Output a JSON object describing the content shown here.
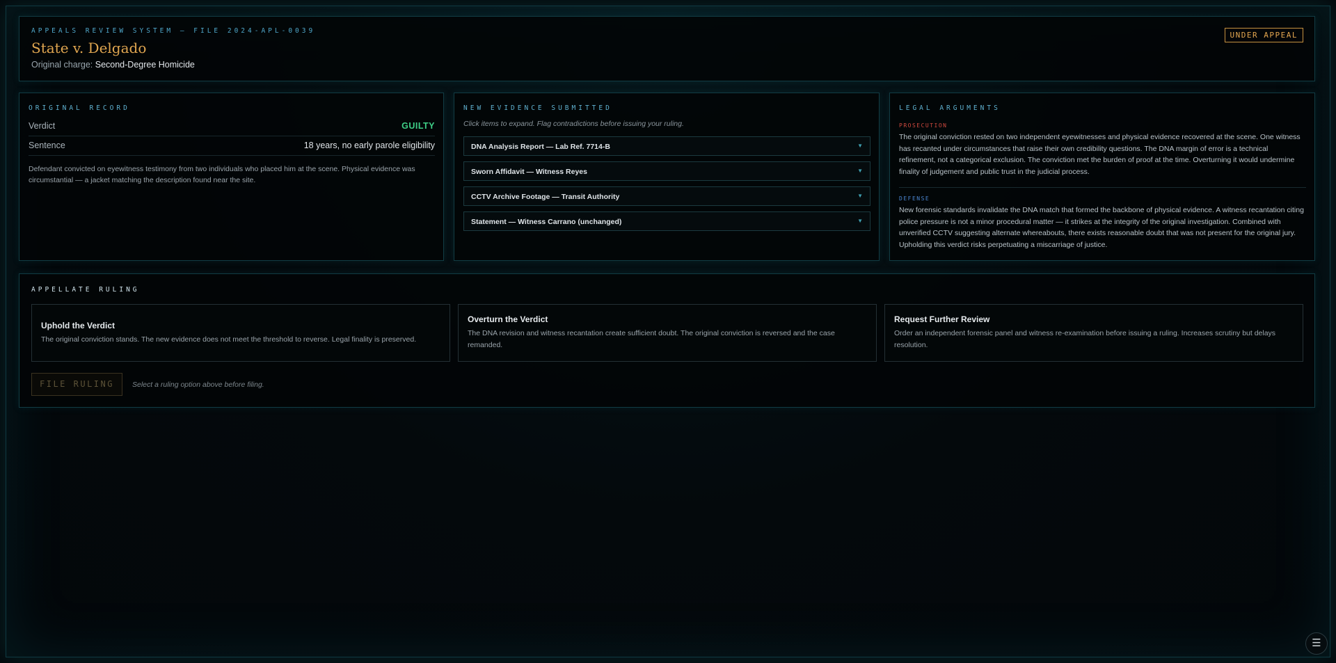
{
  "header": {
    "kicker": "APPEALS REVIEW SYSTEM — FILE 2024-APL-0039",
    "case_title": "State v. Delgado",
    "charge_label": "Original charge:",
    "charge_value": "Second-Degree Homicide",
    "status_badge": "UNDER APPEAL"
  },
  "record": {
    "title": "ORIGINAL RECORD",
    "rows": [
      {
        "label": "Verdict",
        "value": "GUILTY"
      },
      {
        "label": "Sentence",
        "value": "18 years, no early parole eligibility"
      }
    ],
    "note": "Defendant convicted on eyewitness testimony from two individuals who placed him at the scene. Physical evidence was circumstantial — a jacket matching the description found near the site."
  },
  "evidence": {
    "title": "NEW EVIDENCE SUBMITTED",
    "hint": "Click items to expand. Flag contradictions before issuing your ruling.",
    "items": [
      {
        "label": "DNA Analysis Report — Lab Ref. 7714-B",
        "icon": "chevron-down-icon"
      },
      {
        "label": "Sworn Affidavit — Witness Reyes",
        "icon": "chevron-down-icon"
      },
      {
        "label": "CCTV Archive Footage — Transit Authority",
        "icon": "chevron-down-icon"
      },
      {
        "label": "Statement — Witness Carrano (unchanged)",
        "icon": "chevron-down-icon"
      }
    ]
  },
  "arguments": {
    "title": "LEGAL ARGUMENTS",
    "prosecution": {
      "label": "PROSECUTION",
      "text": "The original conviction rested on two independent eyewitnesses and physical evidence recovered at the scene. One witness has recanted under circumstances that raise their own credibility questions. The DNA margin of error is a technical refinement, not a categorical exclusion. The conviction met the burden of proof at the time. Overturning it would undermine finality of judgement and public trust in the judicial process."
    },
    "defense": {
      "label": "DEFENSE",
      "text": "New forensic standards invalidate the DNA match that formed the backbone of physical evidence. A witness recantation citing police pressure is not a minor procedural matter — it strikes at the integrity of the original investigation. Combined with unverified CCTV suggesting alternate whereabouts, there exists reasonable doubt that was not present for the original jury. Upholding this verdict risks perpetuating a miscarriage of justice."
    }
  },
  "ruling": {
    "title": "APPELLATE RULING",
    "options": [
      {
        "title": "Uphold the Verdict",
        "desc": "The original conviction stands. The new evidence does not meet the threshold to reverse. Legal finality is preserved."
      },
      {
        "title": "Overturn the Verdict",
        "desc": "The DNA revision and witness recantation create sufficient doubt. The original conviction is reversed and the case remanded."
      },
      {
        "title": "Request Further Review",
        "desc": "Order an independent forensic panel and witness re-examination before issuing a ruling. Increases scrutiny but delays resolution."
      }
    ],
    "file_button": "FILE RULING",
    "file_hint": "Select a ruling option above before filing."
  },
  "colors": {
    "accent_gold": "#e0a650",
    "accent_cyan": "#4fa6c9",
    "guilty_green": "#3ecf87",
    "prosecution_red": "#d0493f",
    "defense_blue": "#4b86d3"
  },
  "menu": {
    "icon": "menu-icon",
    "glyph": "☰"
  }
}
